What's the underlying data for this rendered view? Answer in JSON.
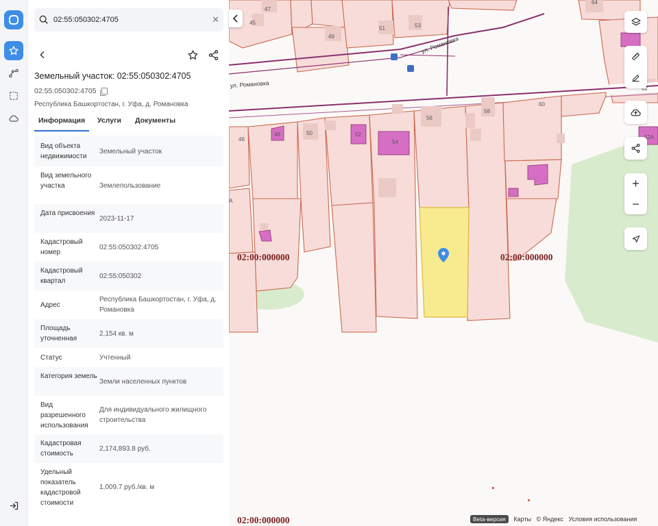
{
  "search": {
    "value": "02:55:050302:4705"
  },
  "header": {
    "title": "Земельный участок: 02:55:050302:4705",
    "cadastral_number": "02:55:050302:4705",
    "address": "Республика Башкортостан, г. Уфа, д. Романовка"
  },
  "tabs": [
    {
      "label": "Информация",
      "active": true
    },
    {
      "label": "Услуги",
      "active": false
    },
    {
      "label": "Документы",
      "active": false
    }
  ],
  "info_rows": [
    {
      "key": "Вид объекта недвижимости",
      "value": "Земельный участок"
    },
    {
      "key": "Вид земельного участка",
      "value": "Землепользование"
    },
    {
      "key": "Дата присвоения",
      "value": "2023-11-17"
    },
    {
      "key": "Кадастровый номер",
      "value": "02:55:050302:4705"
    },
    {
      "key": "Кадастровый квартал",
      "value": "02:55:050302"
    },
    {
      "key": "Адрес",
      "value": "Республика Башкортостан, г. Уфа, д. Романовка"
    },
    {
      "key": "Площадь уточненная",
      "value": "2,154 кв. м"
    },
    {
      "key": "Статус",
      "value": "Учтенный"
    },
    {
      "key": "Категория земель",
      "value": "Земли населенных пунктов"
    },
    {
      "key": "Вид разрешенного использования",
      "value": "Для индивидуального жилищного строительства"
    },
    {
      "key": "Кадастровая стоимость",
      "value": "2,174,893.8 руб."
    },
    {
      "key": "Удельный показатель кадастровой стоимости",
      "value": "1,009.7 руб./кв. м"
    }
  ],
  "map": {
    "street_label_1": "ул. Романовка",
    "street_label_2": "ул. Романовка",
    "quarter_label_1": "02:00:000000",
    "quarter_label_2": "02:00:000000",
    "quarter_label_3": "02:00:000000",
    "house_numbers": [
      "45",
      "47",
      "49",
      "51",
      "53",
      "64",
      "62",
      "46",
      "48",
      "50",
      "52",
      "54",
      "56",
      "58",
      "60",
      "52А",
      "А"
    ],
    "attribution": {
      "beta": "Beta-версия",
      "maps": "Карты",
      "yandex": "© Яндекс",
      "terms": "Условия использования"
    }
  },
  "colors": {
    "accent": "#3e8ee8",
    "parcel_fill": "#f7dcd9",
    "parcel_stroke": "#c9694e",
    "selected_parcel": "#f8ea8f",
    "building": "#d66fc4",
    "road": "#8a2f6e",
    "greenery": "#d9ebcd"
  }
}
